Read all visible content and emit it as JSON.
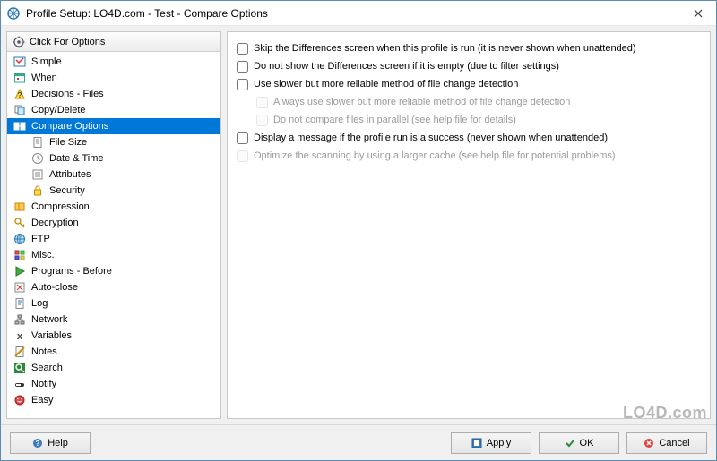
{
  "window": {
    "title": "Profile Setup: LO4D.com - Test - Compare Options"
  },
  "sidebar": {
    "header_label": "Click For Options",
    "items": [
      {
        "label": "Simple"
      },
      {
        "label": "When"
      },
      {
        "label": "Decisions - Files"
      },
      {
        "label": "Copy/Delete"
      },
      {
        "label": "Compare Options"
      },
      {
        "label": "File Size"
      },
      {
        "label": "Date & Time"
      },
      {
        "label": "Attributes"
      },
      {
        "label": "Security"
      },
      {
        "label": "Compression"
      },
      {
        "label": "Decryption"
      },
      {
        "label": "FTP"
      },
      {
        "label": "Misc."
      },
      {
        "label": "Programs - Before"
      },
      {
        "label": "Auto-close"
      },
      {
        "label": "Log"
      },
      {
        "label": "Network"
      },
      {
        "label": "Variables"
      },
      {
        "label": "Notes"
      },
      {
        "label": "Search"
      },
      {
        "label": "Notify"
      },
      {
        "label": "Easy"
      }
    ]
  },
  "options": [
    {
      "label": "Skip the Differences screen when this profile is run (it is never shown when unattended)"
    },
    {
      "label": "Do not show the Differences screen if it is empty (due to filter settings)"
    },
    {
      "label": "Use slower but more reliable method of file change detection"
    },
    {
      "label": "Always use slower but more reliable method of file change detection"
    },
    {
      "label": "Do not compare files in parallel (see help file for details)"
    },
    {
      "label": "Display a message if the profile run is a success (never shown when unattended)"
    },
    {
      "label": "Optimize the scanning by using a larger cache (see help file for potential problems)"
    }
  ],
  "buttons": {
    "help": "Help",
    "apply": "Apply",
    "ok": "OK",
    "cancel": "Cancel"
  },
  "watermark": "LO4D.com"
}
